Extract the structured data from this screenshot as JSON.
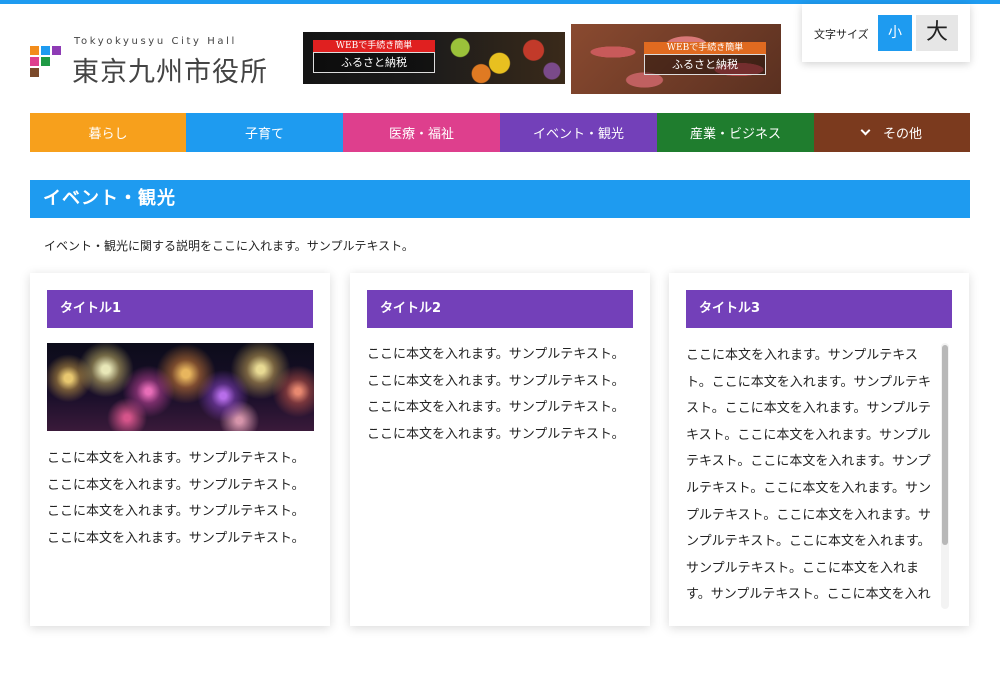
{
  "header": {
    "logo_sub": "Tokyokyusyu City Hall",
    "logo_title": "東京九州市役所",
    "logo_icon": "logo-grid-icon",
    "banners": [
      {
        "tag": "WEBで手続き簡単",
        "text": "ふるさと納税",
        "tag_color": "#e02020"
      },
      {
        "tag": "WEBで手続き簡単",
        "text": "ふるさと納税",
        "tag_color": "#e06a20"
      }
    ],
    "fontsize": {
      "label": "文字サイズ",
      "small": "小",
      "large": "大"
    }
  },
  "nav": {
    "items": [
      {
        "label": "暮らし",
        "color": "#f7a01c"
      },
      {
        "label": "子育て",
        "color": "#1e9bf0"
      },
      {
        "label": "医療・福祉",
        "color": "#de3f8d"
      },
      {
        "label": "イベント・観光",
        "color": "#7340b9"
      },
      {
        "label": "産業・ビジネス",
        "color": "#1f7d2e"
      },
      {
        "label": "その他",
        "color": "#7b3a1e",
        "icon": "chevron-down-icon"
      }
    ]
  },
  "section": {
    "title": "イベント・観光",
    "description": "イベント・観光に関する説明をここに入れます。サンプルテキスト。"
  },
  "cards": [
    {
      "title": "タイトル1",
      "image": "fireworks-image",
      "lines": [
        "ここに本文を入れます。サンプルテキスト。",
        "ここに本文を入れます。サンプルテキスト。",
        "ここに本文を入れます。サンプルテキスト。",
        "ここに本文を入れます。サンプルテキスト。"
      ]
    },
    {
      "title": "タイトル2",
      "lines": [
        "ここに本文を入れます。サンプルテキスト。",
        "ここに本文を入れます。サンプルテキスト。",
        "ここに本文を入れます。サンプルテキスト。",
        "ここに本文を入れます。サンプルテキスト。"
      ]
    },
    {
      "title": "タイトル3",
      "lines": [
        "ここに本文を入れます。サンプルテキス",
        "ト。ここに本文を入れます。サンプルテキ",
        "スト。ここに本文を入れます。サンプルテ",
        "キスト。ここに本文を入れます。サンプル",
        "テキスト。ここに本文を入れます。サンプ",
        "ルテキスト。ここに本文を入れます。サン",
        "プルテキスト。ここに本文を入れます。サ",
        "ンプルテキスト。ここに本文を入れます。",
        "サンプルテキスト。ここに本文を入れま",
        "す。サンプルテキスト。ここに本文を入れ"
      ]
    }
  ],
  "colors": {
    "accent": "#1e9bf0",
    "card_title": "#7340b9"
  }
}
